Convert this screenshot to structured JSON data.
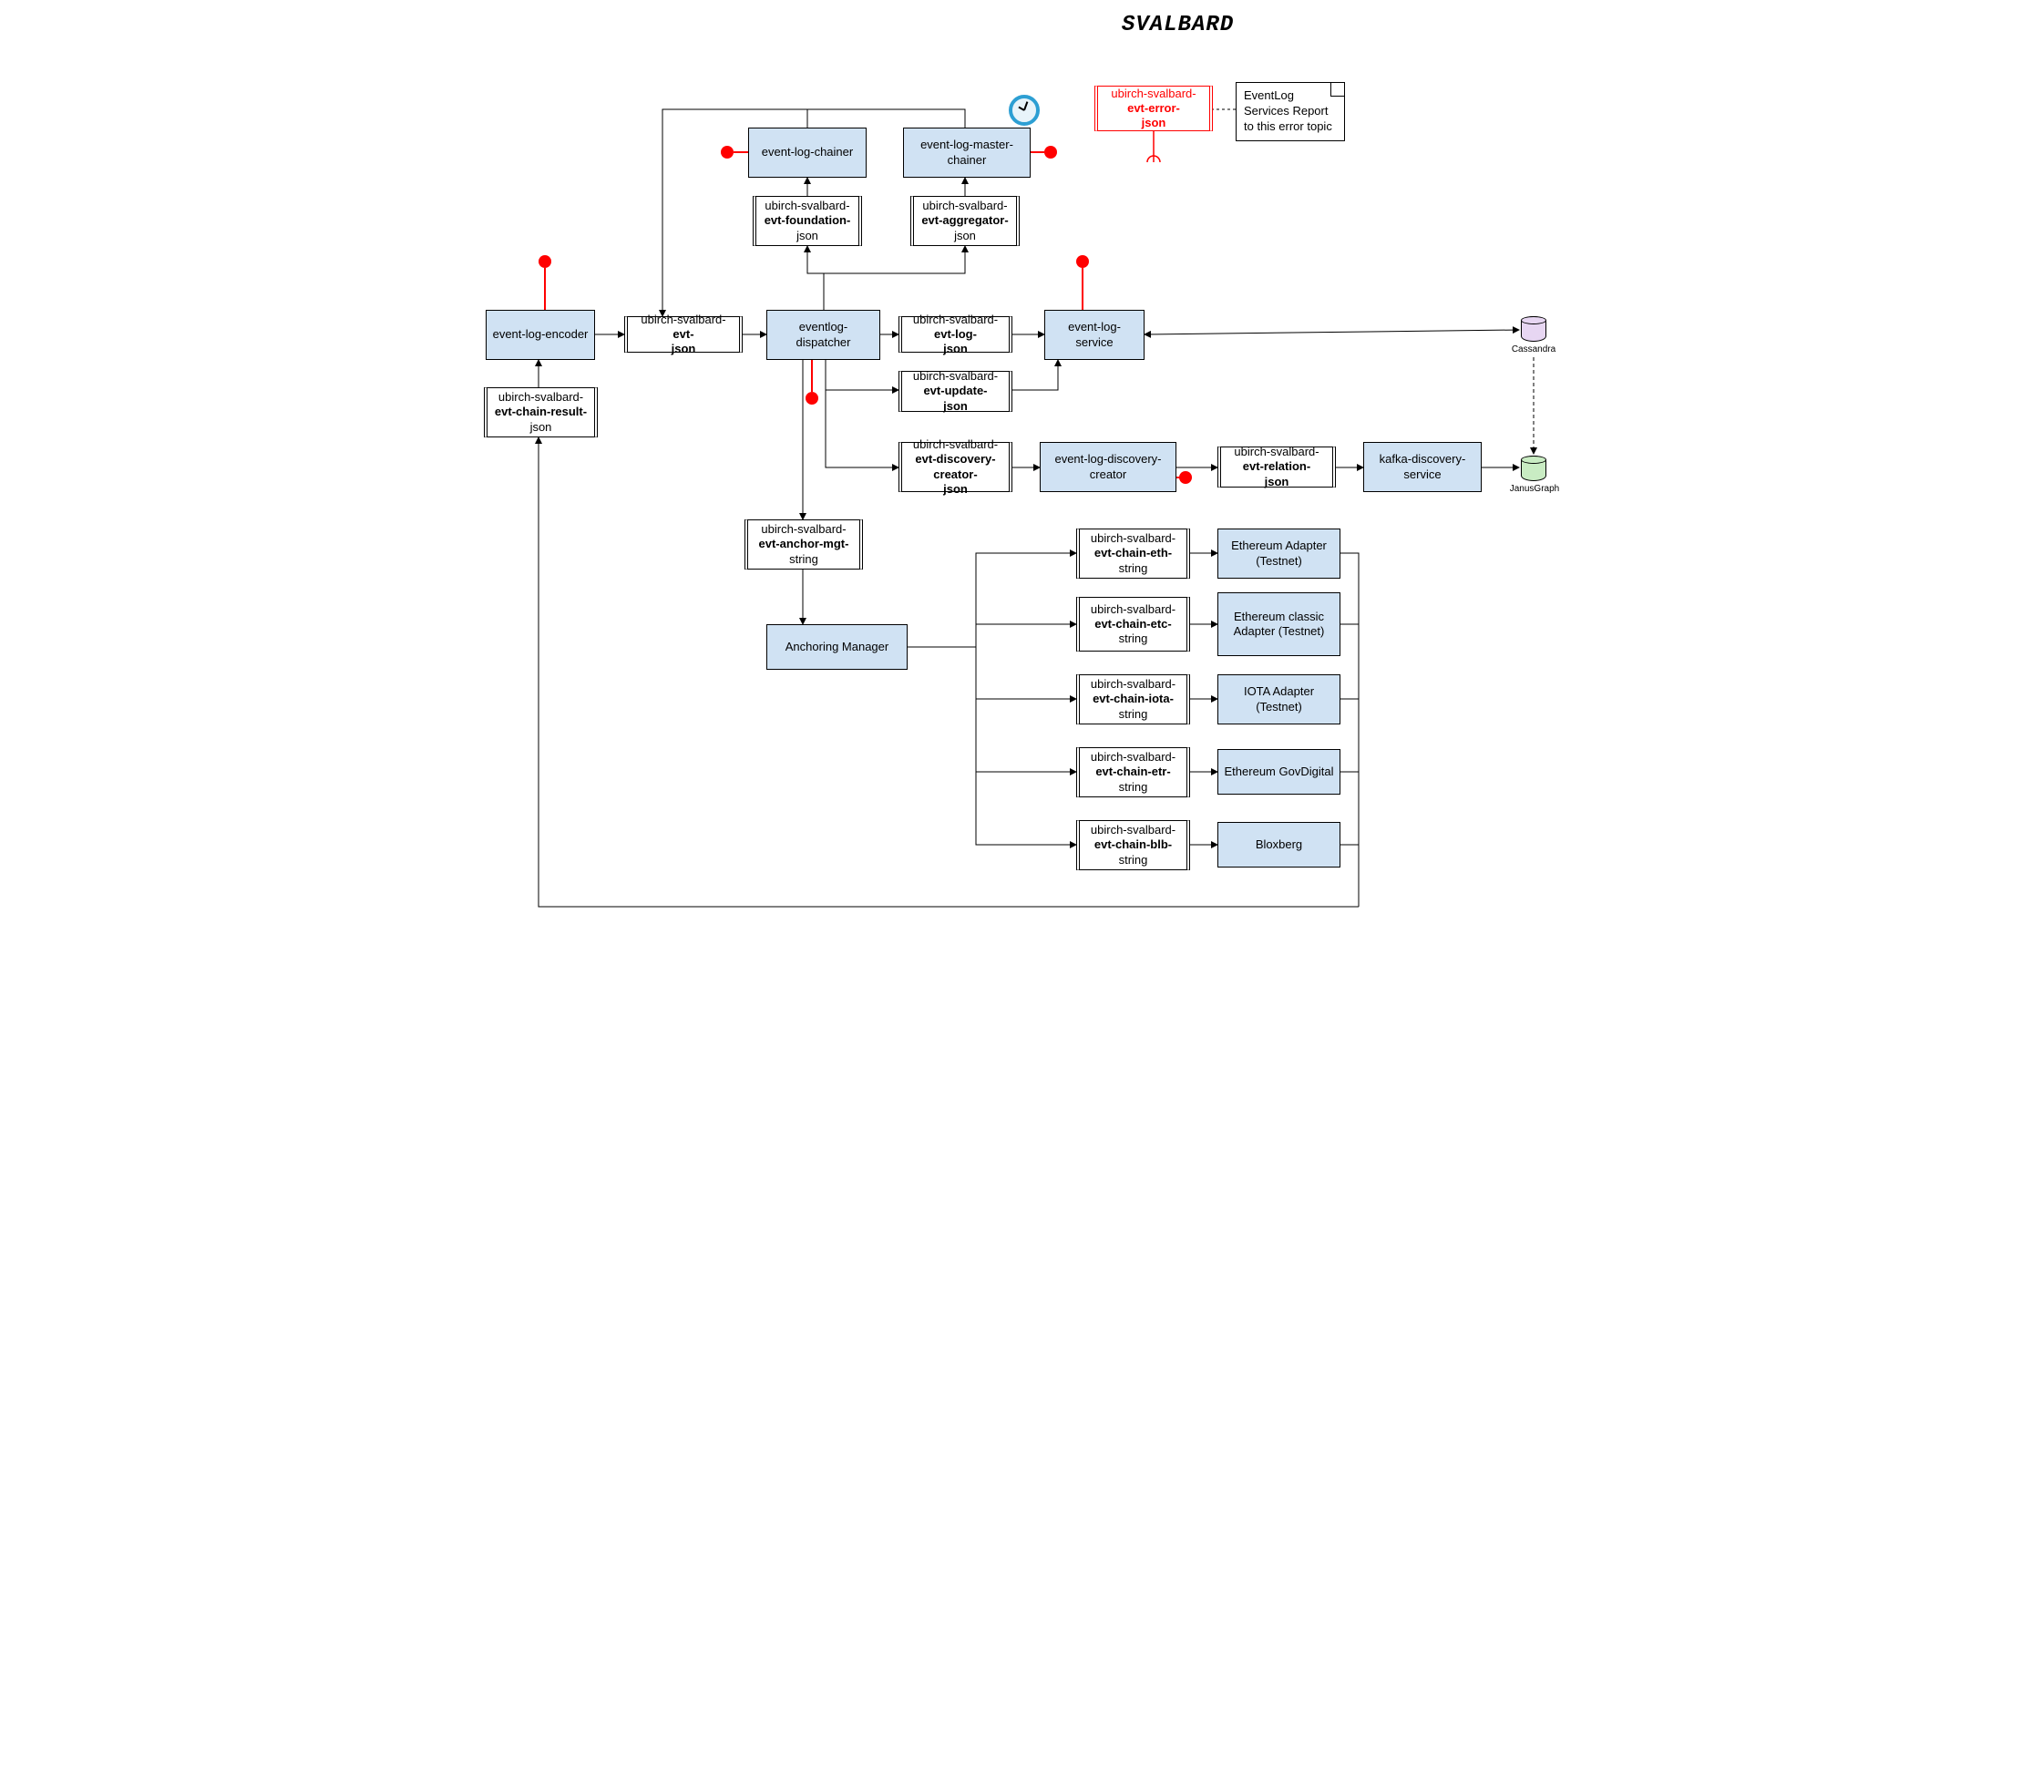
{
  "title": "SVALBARD",
  "note": "EventLog Services Report to this error topic",
  "db": {
    "cassandra": "Cassandra",
    "janus": "JanusGraph"
  },
  "svc": {
    "encoder": "event-log-encoder",
    "chainer": "event-log-chainer",
    "master_chainer": "event-log-master-chainer",
    "dispatcher": "eventlog-dispatcher",
    "service": "event-log-service",
    "discovery_creator": "event-log-discovery-creator",
    "kafka_discovery": "kafka-discovery-service",
    "anchoring_manager": "Anchoring Manager",
    "eth": "Ethereum Adapter (Testnet)",
    "etc": "Ethereum classic Adapter (Testnet)",
    "iota": "IOTA Adapter (Testnet)",
    "etr": "Ethereum GovDigital",
    "blb": "Bloxberg"
  },
  "topic_pre": "ubirch-svalbard-",
  "topic_mid": {
    "chain_result": "evt-chain-result-",
    "evt": "evt-",
    "foundation": "evt-foundation-",
    "aggregator": "evt-aggregator-",
    "log": "evt-log-",
    "update": "evt-update-",
    "discovery_creator": "evt-discovery-creator-",
    "relation": "evt-relation-",
    "anchor_mgt": "evt-anchor-mgt-",
    "chain_eth": "evt-chain-eth-",
    "chain_etc": "evt-chain-etc-",
    "chain_iota": "evt-chain-iota-",
    "chain_etr": "evt-chain-etr-",
    "chain_blb": "evt-chain-blb-",
    "error": "evt-error-"
  },
  "topic_suf": {
    "json": "json",
    "string": "string"
  }
}
